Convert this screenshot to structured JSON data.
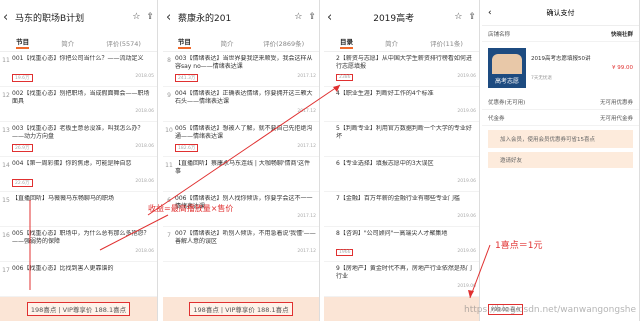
{
  "panels": [
    {
      "title": "马东的职场B计划",
      "tabs": [
        "节目",
        "简介",
        "评价(5574)"
      ],
      "episodes": [
        {
          "num": "11",
          "title": "001【找重心态】你把公司当什么？——流动定义",
          "plays": "19.6万",
          "date": "2018.05"
        },
        {
          "num": "12",
          "title": "002【找重心态】别把职场，当成假面舞会——职场面具",
          "plays": "",
          "date": "2018.06"
        },
        {
          "num": "13",
          "title": "003【找重心态】老板主意总没准，叫我怎么办？——动力方向盘",
          "plays": "26.9万",
          "date": "2018.06"
        },
        {
          "num": "14",
          "title": "004【第一周彩蛋】你的焦虑，可能是种自恋",
          "plays": "22.6万",
          "date": "2018.06"
        },
        {
          "num": "15",
          "title": "【直播回听】马薇薇马东畅聊马的职场",
          "plays": "",
          "date": ""
        },
        {
          "num": "16",
          "title": "005【找重心态】职场中，为什么总有那么多抱怨？——强弱势的保障",
          "plays": "",
          "date": "2018.06"
        },
        {
          "num": "17",
          "title": "006【找重心态】比找到害人更靠谱的",
          "plays": "",
          "date": ""
        }
      ],
      "bar": "198喜点 | VIP尊享价 188.1喜点"
    },
    {
      "title": "蔡康永的201",
      "tabs": [
        "节目",
        "简介",
        "评价(2869条)"
      ],
      "episodes": [
        {
          "num": "8",
          "title": "003【情绪表达】当世界要我逆来顺受，我会这样从容say no——情绪表达课",
          "plays": "241.3万",
          "date": "2017.12"
        },
        {
          "num": "9",
          "title": "004【情绪表达】正确表达情绪，你要拥开这三颗大石头——情绪表达课",
          "plays": "",
          "date": "2017.12"
        },
        {
          "num": "10",
          "title": "005【情绪表达】想被人了解，就不要自己先拒绝沟通——情绪表达课",
          "plays": "182.6万",
          "date": "2017.12"
        },
        {
          "num": "11",
          "title": "【直播回听】蔡康永马东连线 | 大咖畅聊'情商'这件事",
          "plays": "",
          "date": ""
        },
        {
          "num": "6",
          "title": "006【情绪表达】别人找你倾诉，你要学会这不一一情绪表达课",
          "plays": "",
          "date": "2017.12"
        },
        {
          "num": "7",
          "title": "007【情绪表达】听别人倾诉，不用急着说'我懂'——善解人意的误区",
          "plays": "",
          "date": "2017.12"
        }
      ],
      "bar": "198喜点 | VIP尊享价 188.1喜点"
    },
    {
      "title": "2019高考",
      "tabs": [
        "目录",
        "简介",
        "评价(11条)"
      ],
      "episodes": [
        {
          "num": "",
          "title": "2【薪资与志愿】从中国大学生薪资排行榜看如何进行志愿填报",
          "plays": "2386",
          "date": "2019.06"
        },
        {
          "num": "",
          "title": "4【职业生涯】判断好工作的4个标准",
          "plays": "",
          "date": "2019.06"
        },
        {
          "num": "",
          "title": "5【判断专业】利用官方数据判断一个大学的专业好坏",
          "plays": "",
          "date": ""
        },
        {
          "num": "",
          "title": "6【专业选择】填报志愿中的3大误区",
          "plays": "",
          "date": "2019.06"
        },
        {
          "num": "",
          "title": "7【金融】百万年薪的金融行业有哪些专业门槛",
          "plays": "",
          "date": "2019.06"
        },
        {
          "num": "",
          "title": "8【咨询】\"公司顾问\"一高端尖人才聚集地",
          "plays": "1966",
          "date": "2019.06"
        },
        {
          "num": "",
          "title": "9【房地产】黄金时代不再，房地产行业依然是热门行业",
          "plays": "",
          "date": "2019.06"
        }
      ],
      "bar": ""
    },
    {
      "title": "确认支付",
      "shop_label": "店铺名称",
      "shop": "快晓社群",
      "product": "2019高考志愿填报50讲",
      "price": "¥ 99.00",
      "tag": "7天无忧退",
      "cover_text": "高考志愿",
      "rows": [
        {
          "k": "优惠券(无可用)",
          "v": "无可用优惠券"
        },
        {
          "k": "代金券",
          "v": "无可用代金券"
        }
      ],
      "vip": "加入会员，使用会员优惠券可省15喜点",
      "vip2": "邀请好友",
      "foot": "¥99.00 喜点"
    }
  ],
  "annotations": {
    "income": "收益=最高播放量×售价",
    "ratio": "1喜点＝1元"
  },
  "watermark": "https://blog.csdn.net/wanwangongshe"
}
